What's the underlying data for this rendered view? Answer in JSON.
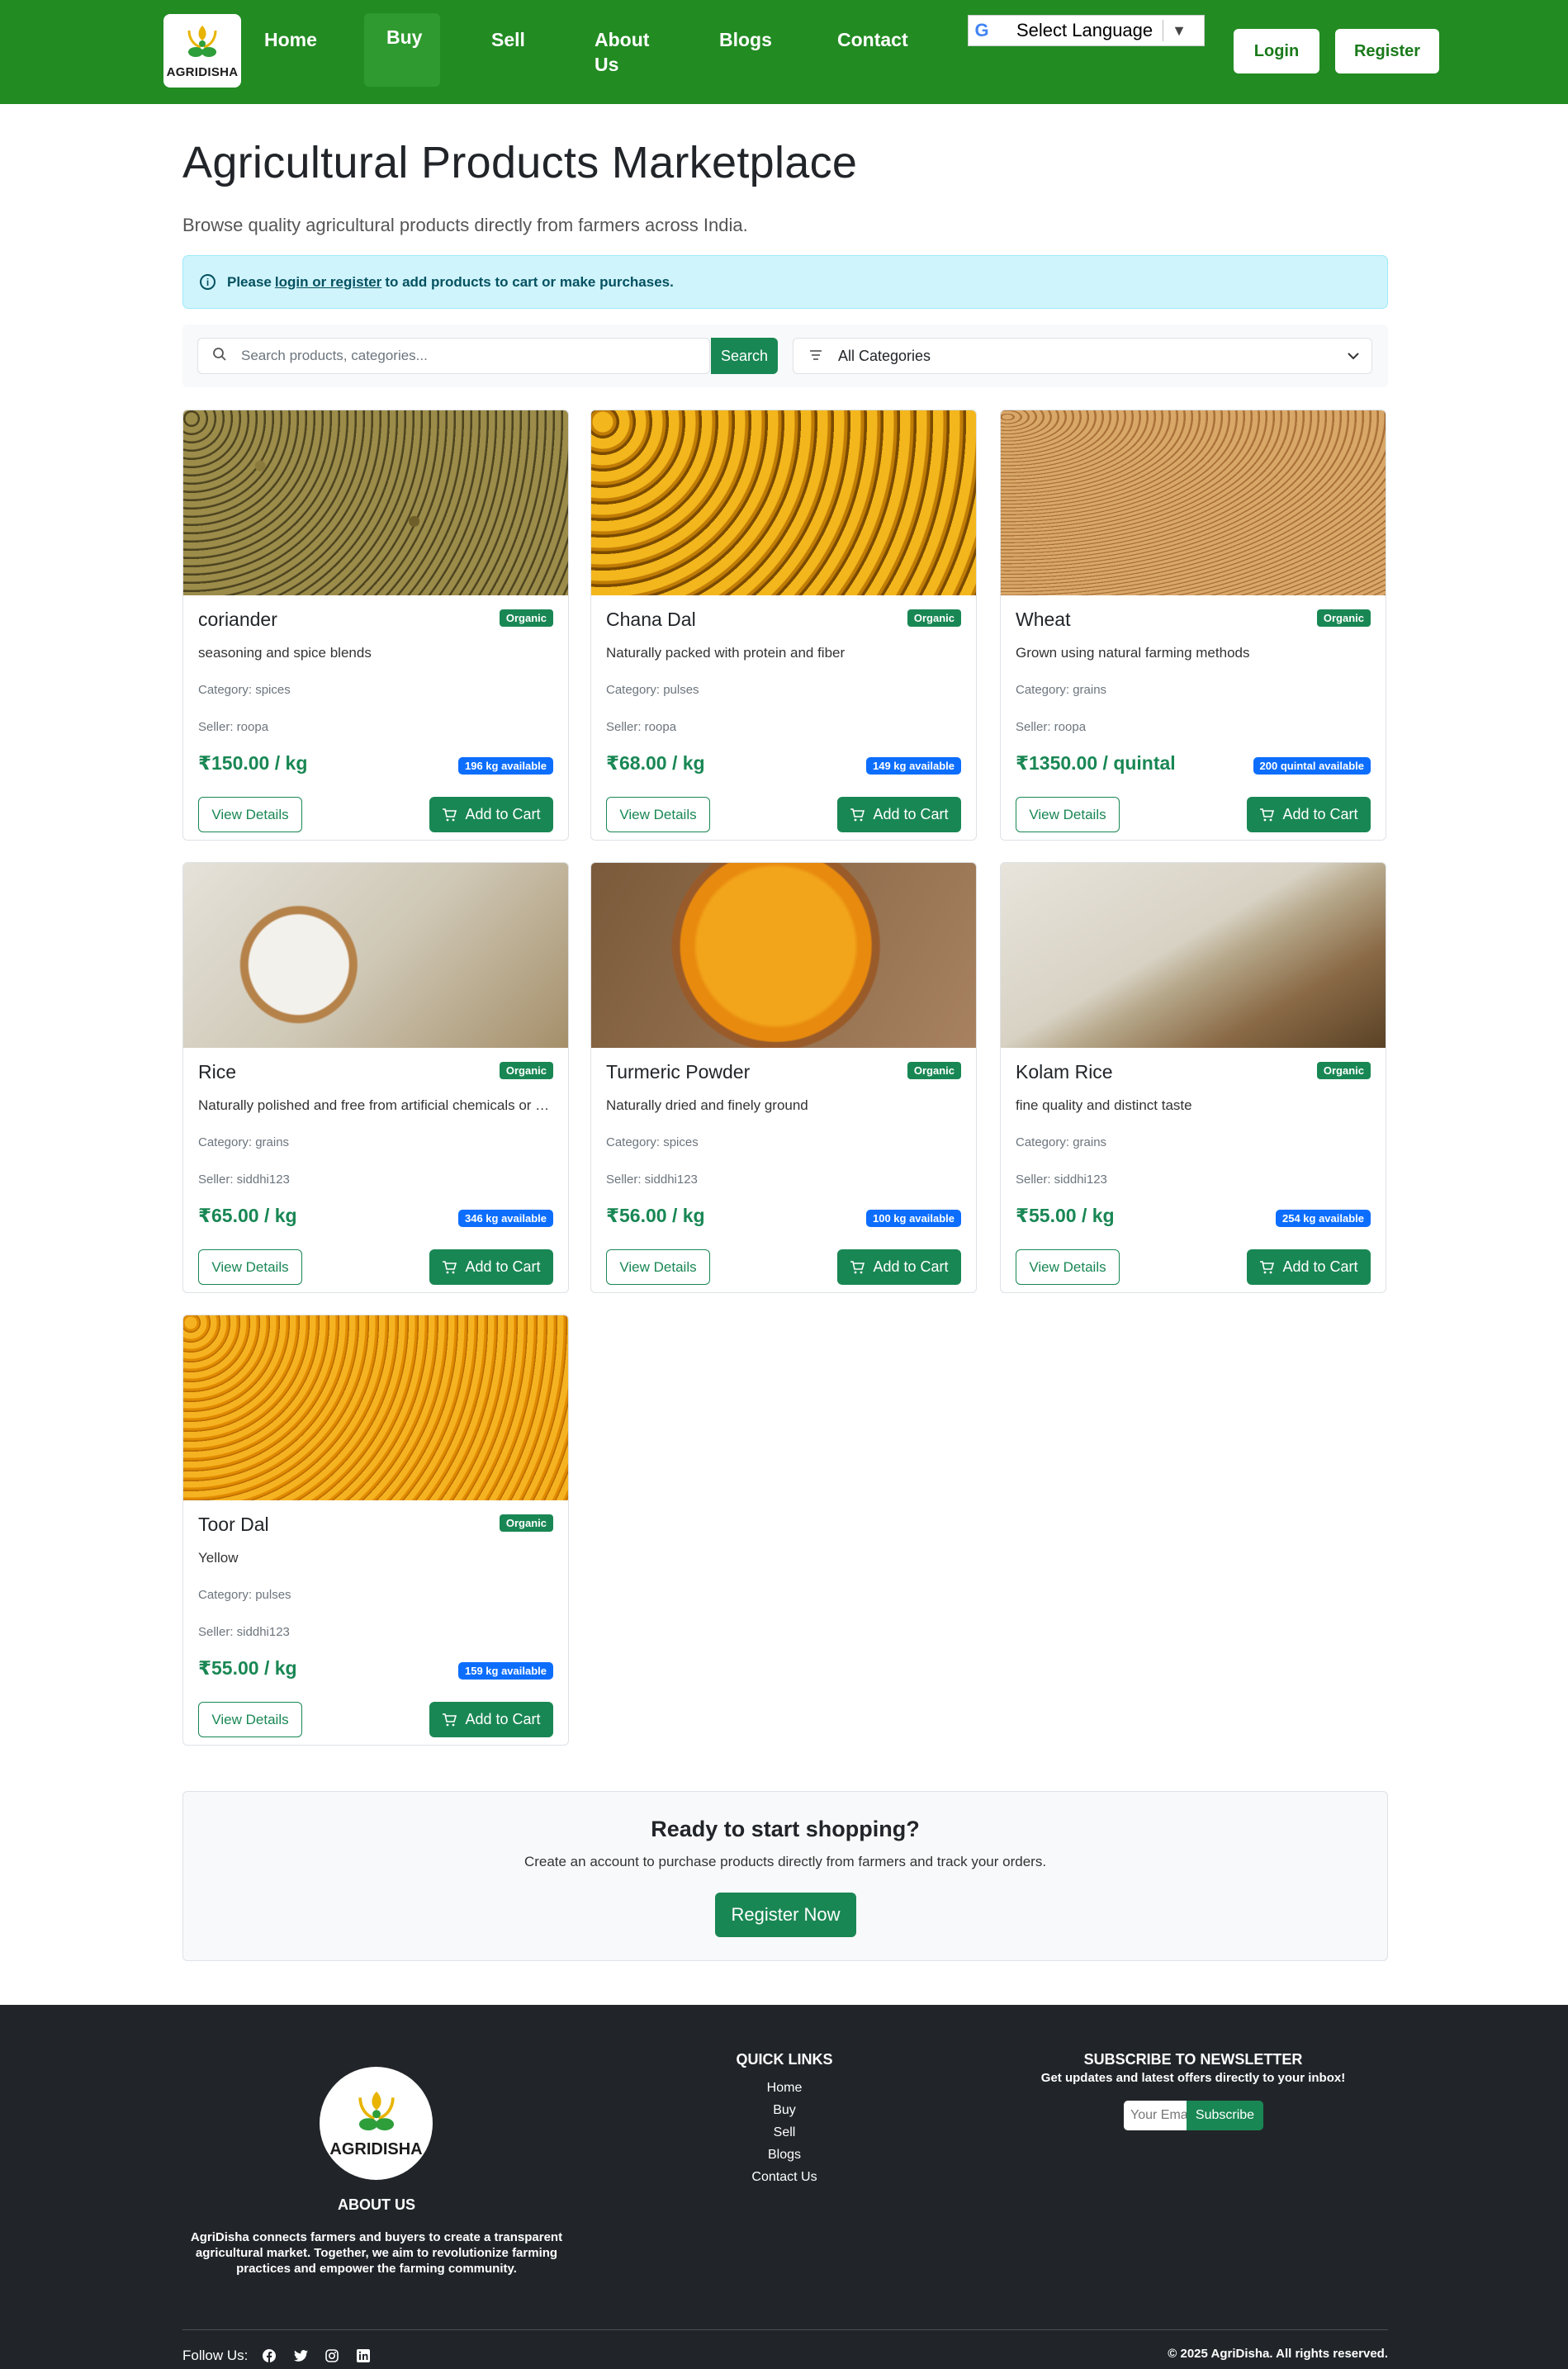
{
  "nav": {
    "logo_text": "AGRIDISHA",
    "links": [
      "Home",
      "Buy",
      "Sell",
      "About\nUs",
      "Blogs",
      "Contact"
    ],
    "active": "Buy",
    "language": "Select Language",
    "login": "Login",
    "register": "Register"
  },
  "header": {
    "title": "Agricultural Products Marketplace",
    "subtitle": "Browse quality agricultural products directly from farmers across India."
  },
  "alert": {
    "pre": "Please",
    "link": "login or register",
    "post": "to add products to cart or make purchases."
  },
  "search": {
    "placeholder": "Search products, categories...",
    "button": "Search",
    "category": "All Categories"
  },
  "products": [
    {
      "name": "coriander",
      "badge": "Organic",
      "desc": "seasoning and spice blends",
      "category": "Category: spices",
      "seller": "Seller: roopa",
      "price": "₹150.00 / kg",
      "available": "196 kg available",
      "image": "coriander-seeds"
    },
    {
      "name": "Chana Dal",
      "badge": "Organic",
      "desc": "Naturally packed with protein and fiber",
      "category": "Category: pulses",
      "seller": "Seller: roopa",
      "price": "₹68.00 / kg",
      "available": "149 kg available",
      "image": "chana-dal"
    },
    {
      "name": "Wheat",
      "badge": "Organic",
      "desc": "Grown using natural farming methods",
      "category": "Category: grains",
      "seller": "Seller: roopa",
      "price": "₹1350.00 / quintal",
      "available": "200 quintal available",
      "image": "wheat-grains"
    },
    {
      "name": "Rice",
      "badge": "Organic",
      "desc": "Naturally polished and free from artificial chemicals or preservatives",
      "category": "Category: grains",
      "seller": "Seller: siddhi123",
      "price": "₹65.00 / kg",
      "available": "346 kg available",
      "image": "rice-spoon"
    },
    {
      "name": "Turmeric Powder",
      "badge": "Organic",
      "desc": "Naturally dried and finely ground",
      "category": "Category: spices",
      "seller": "Seller: siddhi123",
      "price": "₹56.00 / kg",
      "available": "100 kg available",
      "image": "turmeric-bowl"
    },
    {
      "name": "Kolam Rice",
      "badge": "Organic",
      "desc": "fine quality and distinct taste",
      "category": "Category: grains",
      "seller": "Seller: siddhi123",
      "price": "₹55.00 / kg",
      "available": "254 kg available",
      "image": "kolam-rice"
    },
    {
      "name": "Toor Dal",
      "badge": "Organic",
      "desc": "Yellow",
      "category": "Category: pulses",
      "seller": "Seller: siddhi123",
      "price": "₹55.00 / kg",
      "available": "159 kg available",
      "image": "toor-dal"
    }
  ],
  "card_buttons": {
    "view": "View Details",
    "cart": "Add to Cart"
  },
  "cta": {
    "title": "Ready to start shopping?",
    "text": "Create an account to purchase products directly from farmers and track your orders.",
    "button": "Register Now"
  },
  "footer": {
    "logo_text": "AGRIDISHA",
    "about_title": "ABOUT US",
    "about_text": "AgriDisha connects farmers and buyers to create a transparent agricultural market. Together, we aim to revolutionize farming practices and empower the farming community.",
    "quick_title": "QUICK LINKS",
    "quick_links": [
      "Home",
      "Buy",
      "Sell",
      "Blogs",
      "Contact Us"
    ],
    "news_title": "SUBSCRIBE TO NEWSLETTER",
    "news_sub": "Get updates and latest offers directly to your inbox!",
    "email_placeholder": "Your Email",
    "subscribe": "Subscribe",
    "follow": "Follow Us:",
    "copyright": "© 2025 AgriDisha. All rights reserved."
  },
  "colors": {
    "nav": "#228b22",
    "accent": "#198754",
    "badge_blue": "#0d6efd",
    "footer": "#212529",
    "alert_bg": "#cff4fc"
  }
}
